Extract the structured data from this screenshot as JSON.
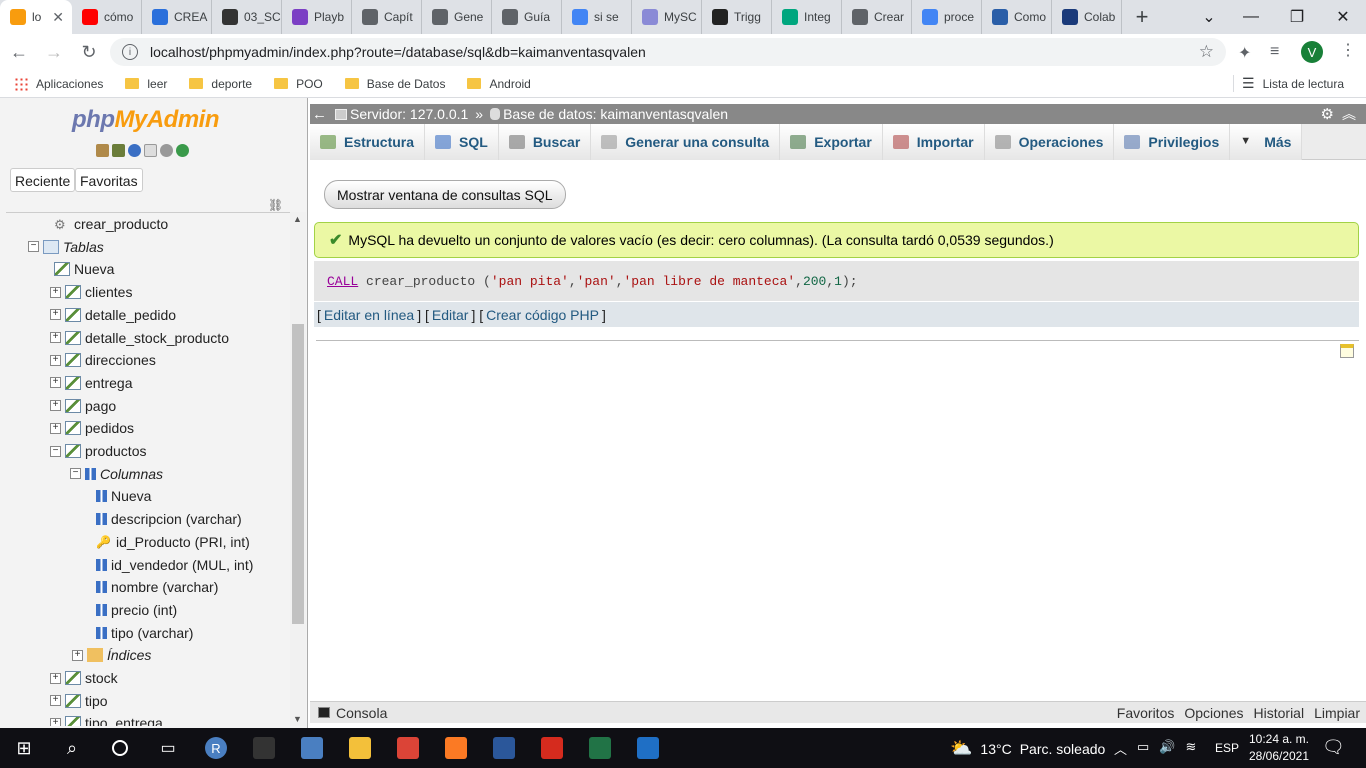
{
  "browser": {
    "tabs": [
      {
        "label": "lo",
        "color": "#f89c0e"
      },
      {
        "label": "cómo",
        "color": "#ff0000"
      },
      {
        "label": "CREA",
        "color": "#2a6fdb"
      },
      {
        "label": "03_SC",
        "color": "#333333"
      },
      {
        "label": "Playb",
        "color": "#7b3fc4"
      },
      {
        "label": "Capít",
        "color": "#5f6368"
      },
      {
        "label": "Gene",
        "color": "#5f6368"
      },
      {
        "label": "Guía",
        "color": "#5f6368"
      },
      {
        "label": "si se",
        "color": "#4285f4"
      },
      {
        "label": "MySC",
        "color": "#8a8ad6"
      },
      {
        "label": "Trigg",
        "color": "#222222"
      },
      {
        "label": "Integ",
        "color": "#00a67e"
      },
      {
        "label": "Crear",
        "color": "#5f6368"
      },
      {
        "label": "proce",
        "color": "#4285f4"
      },
      {
        "label": "Como",
        "color": "#2a5ea8"
      },
      {
        "label": "Colab",
        "color": "#1a3a7a"
      }
    ],
    "url": "localhost/phpmyadmin/index.php?route=/database/sql&db=kaimanventasqvalen",
    "profile_initial": "V",
    "bookmarks": [
      "Aplicaciones",
      "leer",
      "deporte",
      "POO",
      "Base de Datos",
      "Android"
    ],
    "reading_list": "Lista de lectura"
  },
  "sidebar": {
    "logo_php": "php",
    "logo_ma": "MyAdmin",
    "recent": "Reciente",
    "favorites": "Favoritas",
    "tree": [
      {
        "label": "crear_producto",
        "kind": "proc"
      },
      {
        "label": "Tablas",
        "kind": "group"
      },
      {
        "label": "Nueva",
        "kind": "new"
      },
      {
        "label": "clientes",
        "kind": "table"
      },
      {
        "label": "detalle_pedido",
        "kind": "table"
      },
      {
        "label": "detalle_stock_producto",
        "kind": "table"
      },
      {
        "label": "direcciones",
        "kind": "table"
      },
      {
        "label": "entrega",
        "kind": "table"
      },
      {
        "label": "pago",
        "kind": "table"
      },
      {
        "label": "pedidos",
        "kind": "table"
      },
      {
        "label": "productos",
        "kind": "table-open"
      },
      {
        "label": "Columnas",
        "kind": "colgroup"
      },
      {
        "label": "Nueva",
        "kind": "colnew"
      },
      {
        "label": "descripcion (varchar)",
        "kind": "col"
      },
      {
        "label": "id_Producto (PRI, int)",
        "kind": "key"
      },
      {
        "label": "id_vendedor (MUL, int)",
        "kind": "col"
      },
      {
        "label": "nombre (varchar)",
        "kind": "col"
      },
      {
        "label": "precio (int)",
        "kind": "col"
      },
      {
        "label": "tipo (varchar)",
        "kind": "col"
      },
      {
        "label": "Índices",
        "kind": "idx"
      },
      {
        "label": "stock",
        "kind": "table"
      },
      {
        "label": "tipo",
        "kind": "table"
      },
      {
        "label": "tipo_entrega",
        "kind": "table"
      }
    ]
  },
  "main": {
    "server": "Servidor: 127.0.0.1",
    "sep": "»",
    "database": "Base de datos: kaimanventasqvalen",
    "tabs": [
      "Estructura",
      "SQL",
      "Buscar",
      "Generar una consulta",
      "Exportar",
      "Importar",
      "Operaciones",
      "Privilegios",
      "Más"
    ],
    "show_sql_button": "Mostrar ventana de consultas SQL",
    "success_message": "MySQL ha devuelto un conjunto de valores vacío (es decir: cero columnas). (La consulta tardó 0,0539 segundos.)",
    "sql": {
      "keyword": "CALL",
      "proc": " crear_producto (",
      "arg1": "'pan pita'",
      "c1": ",",
      "arg2": "'pan'",
      "c2": ",",
      "arg3": "'pan libre de manteca'",
      "c3": ",",
      "arg4": "200",
      "c4": ",",
      "arg5": "1",
      "end": ");"
    },
    "edit_links": {
      "inline": "Editar en línea",
      "edit": "Editar",
      "php": "Crear código PHP"
    },
    "console": "Consola",
    "console_links": [
      "Favoritos",
      "Opciones",
      "Historial",
      "Limpiar"
    ]
  },
  "taskbar": {
    "weather_temp": "13°C",
    "weather_desc": "Parc. soleado",
    "lang": "ESP",
    "time": "10:24 a. m.",
    "date": "28/06/2021",
    "apps": [
      {
        "name": "R",
        "color": "#4a7fc1"
      },
      {
        "name": "cmd",
        "color": "#333333"
      },
      {
        "name": "calc",
        "color": "#4a7fc1"
      },
      {
        "name": "explorer",
        "color": "#f3c03a"
      },
      {
        "name": "chrome",
        "color": "#db4437"
      },
      {
        "name": "xampp",
        "color": "#fb7a24"
      },
      {
        "name": "word",
        "color": "#2b579a"
      },
      {
        "name": "acrobat",
        "color": "#d52b1e"
      },
      {
        "name": "excel",
        "color": "#217346"
      },
      {
        "name": "vs",
        "color": "#1f6fc5"
      }
    ]
  }
}
